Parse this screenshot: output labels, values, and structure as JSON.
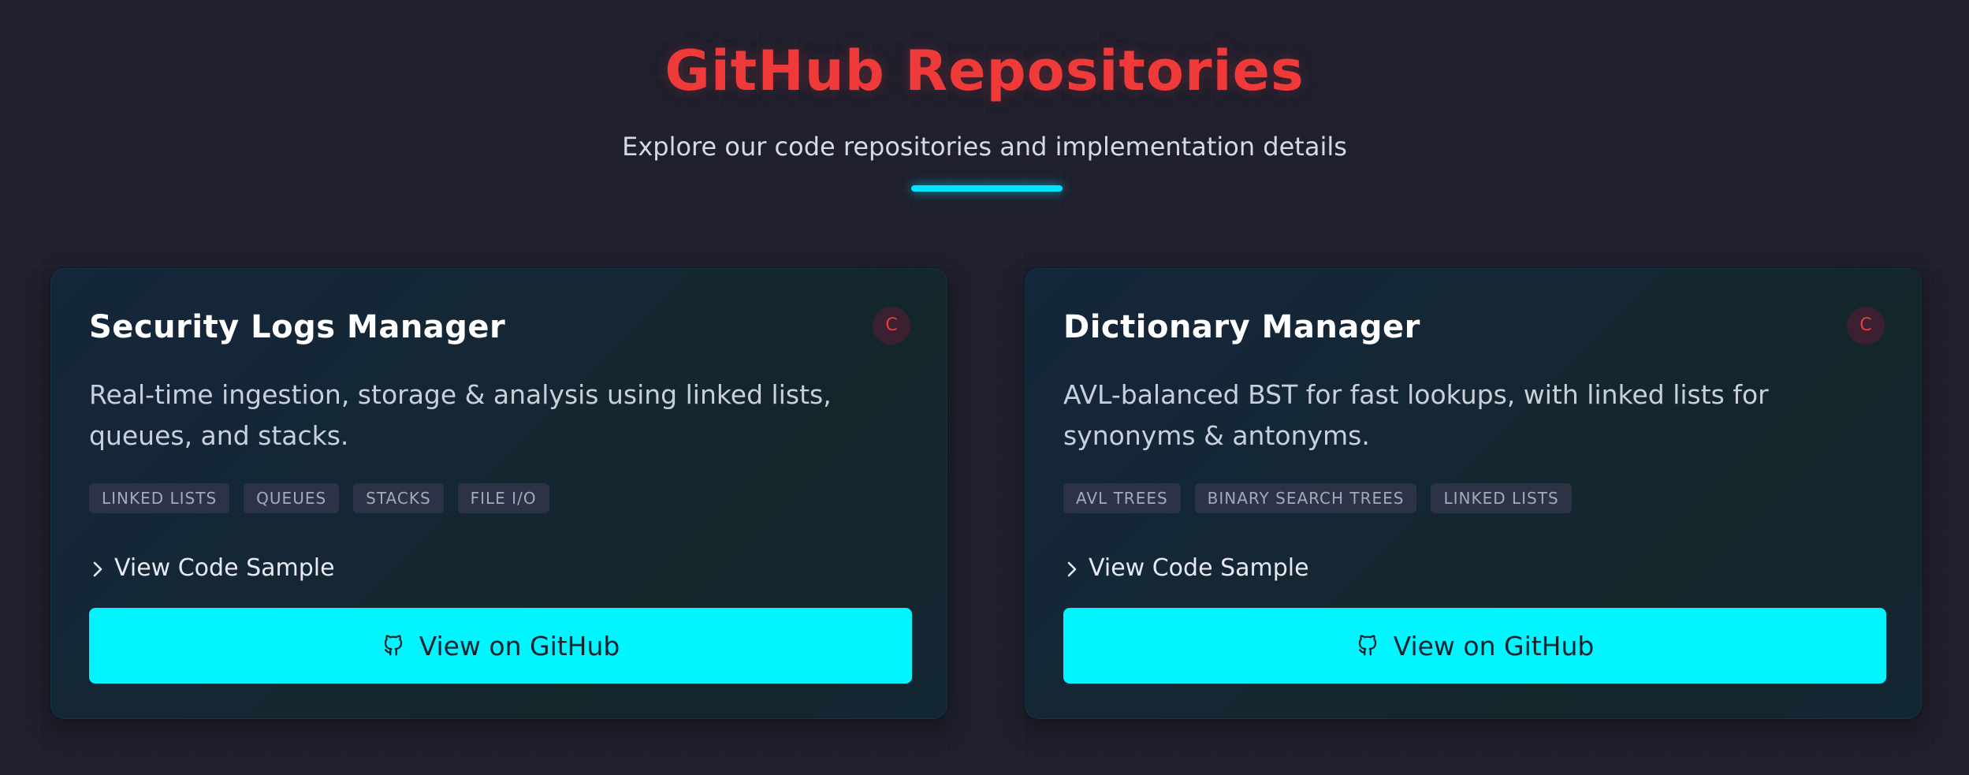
{
  "header": {
    "title": "GitHub Repositories",
    "subtitle": "Explore our code repositories and implementation details"
  },
  "colors": {
    "accent": "#00f5ff",
    "title_red": "#f03a3a",
    "background": "#1f1f2d"
  },
  "cards": [
    {
      "title": "Security Logs Manager",
      "language_badge": "C",
      "description": "Real-time ingestion, storage & analysis using linked lists, queues, and stacks.",
      "tags": [
        "LINKED LISTS",
        "QUEUES",
        "STACKS",
        "FILE I/O"
      ],
      "code_toggle_label": "View Code Sample",
      "github_button_label": "View on GitHub",
      "icons": {
        "toggle": "chevron-right-icon",
        "button": "github-icon"
      }
    },
    {
      "title": "Dictionary Manager",
      "language_badge": "C",
      "description": "AVL-balanced BST for fast lookups, with linked lists for synonyms & antonyms.",
      "tags": [
        "AVL TREES",
        "BINARY SEARCH TREES",
        "LINKED LISTS"
      ],
      "code_toggle_label": "View Code Sample",
      "github_button_label": "View on GitHub",
      "icons": {
        "toggle": "chevron-right-icon",
        "button": "github-icon"
      }
    }
  ]
}
